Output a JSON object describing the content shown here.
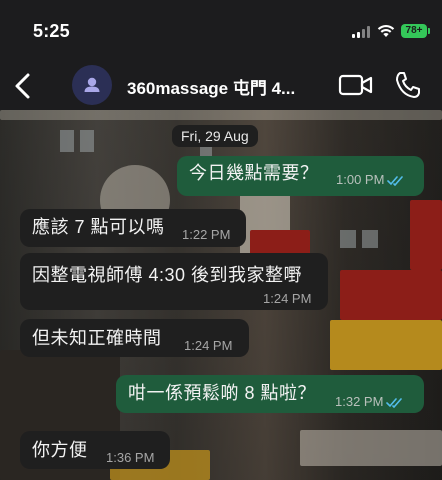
{
  "status_bar": {
    "time": "5:25",
    "battery": "78+",
    "icons": [
      "signal-bars-icon",
      "wifi-icon",
      "battery-icon"
    ]
  },
  "header": {
    "contact_name": "360massage 屯門 4...",
    "icons": [
      "back-chevron-icon",
      "person-avatar-icon",
      "video-call-icon",
      "phone-icon"
    ]
  },
  "chat": {
    "date_label": "Fri, 29 Aug",
    "messages": [
      {
        "direction": "out",
        "text": "今日幾點需要？",
        "time": "1:00 PM",
        "read": true
      },
      {
        "direction": "in",
        "text": "應該 7 點可以嗎",
        "time": "1:22 PM"
      },
      {
        "direction": "in",
        "text": "因整電視師傅 4:30 後到我家整嘢",
        "time": "1:24 PM"
      },
      {
        "direction": "in",
        "text": "但未知正確時間",
        "time": "1:24 PM"
      },
      {
        "direction": "out",
        "text": "咁一係預鬆啲 8 點啦？",
        "time": "1:32 PM",
        "read": true
      },
      {
        "direction": "in",
        "text": "你方便",
        "time": "1:36 PM"
      }
    ]
  },
  "colors": {
    "incoming_bubble": "#1f1f1f",
    "outgoing_bubble": "#1f5c3c",
    "read_ticks": "#53bdeb",
    "battery": "#34c759"
  }
}
